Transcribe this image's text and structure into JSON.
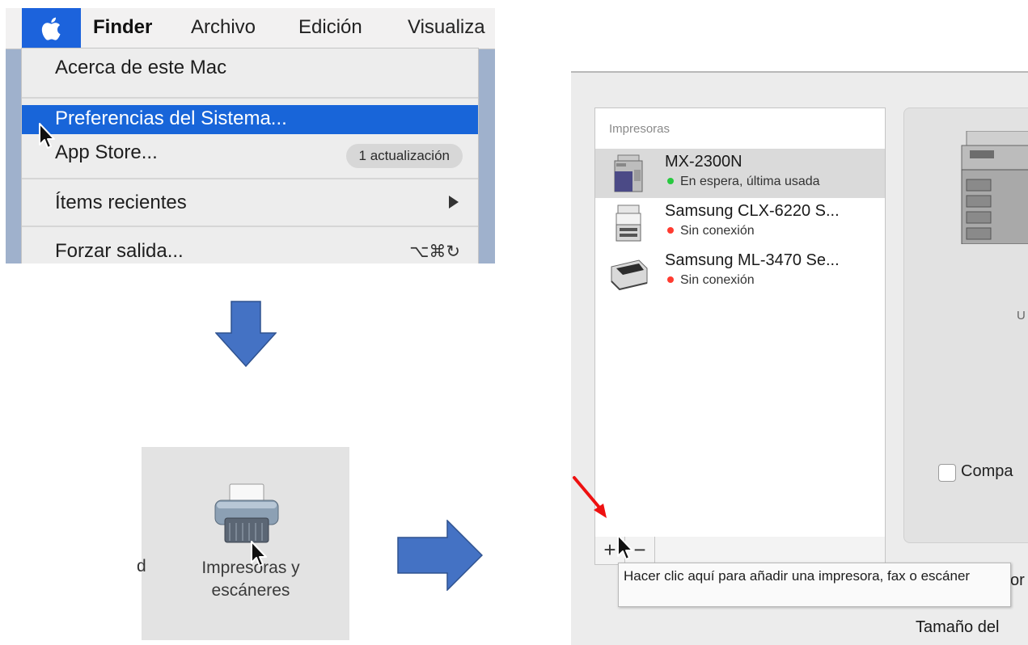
{
  "menubar": {
    "items": [
      "Finder",
      "Archivo",
      "Edición",
      "Visualiza"
    ]
  },
  "apple_menu": {
    "about": "Acerca de este Mac",
    "preferences": "Preferencias del Sistema...",
    "app_store": "App Store...",
    "app_store_badge": "1 actualización",
    "recent_items": "Ítems recientes",
    "force_quit": "Forzar salida...",
    "force_quit_shortcut": "⌥⌘↻"
  },
  "prefs_pane": {
    "partial_left": "d",
    "label": "Impresoras y escáneres"
  },
  "printers_window": {
    "list_header": "Impresoras",
    "printers": [
      {
        "name": "MX-2300N",
        "status": "En espera, última usada",
        "status_color": "#28c940"
      },
      {
        "name": "Samsung CLX-6220 S...",
        "status": "Sin conexión",
        "status_color": "#ff3b30"
      },
      {
        "name": "Samsung ML-3470 Se...",
        "status": "Sin conexión",
        "status_color": "#ff3b30"
      }
    ],
    "add_button": "+",
    "remove_button": "−",
    "detail_partial_u": "U",
    "share_label": "Compa",
    "detail_partial_char": "or",
    "tamano_label": "Tamaño del",
    "tooltip": "Hacer clic aquí para añadir una impresora, fax o escáner"
  },
  "colors": {
    "menu_highlight": "#1865d9",
    "arrow_fill": "#4472c4",
    "arrow_stroke": "#2f528f",
    "red_arrow": "#ee1111"
  }
}
